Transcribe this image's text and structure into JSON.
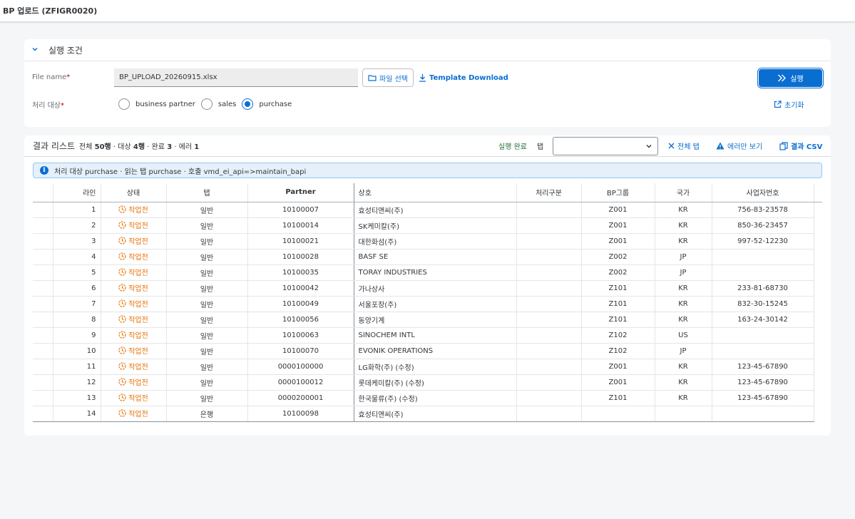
{
  "shell": {
    "title": "BP 업로드 (ZFIGR0020)"
  },
  "conditions": {
    "title": "실행 조건",
    "file_label": "File name",
    "file_value": "BP_UPLOAD_20260915.xlsx",
    "file_select_label": "파일 선택",
    "template_download_label": "Template Download",
    "run_label": "실행",
    "target_label": "처리 대상",
    "options": [
      {
        "label": "business partner",
        "selected": false
      },
      {
        "label": "sales",
        "selected": false
      },
      {
        "label": "purchase",
        "selected": true
      }
    ],
    "reset_label": "초기화"
  },
  "results": {
    "title": "결과 리스트",
    "summary": {
      "total_prefix": "전체",
      "total": "50행",
      "target_prefix": "· 대상",
      "target": "4행",
      "done_prefix": "· 완료",
      "done": "3",
      "error_prefix": "· 에러",
      "error": "1"
    },
    "run_status": "실행 완료",
    "tab_label": "탭",
    "tab_value": "",
    "all_tabs_label": "전체 탭",
    "errors_only_label": "에러만 보기",
    "csv_label": "결과 CSV",
    "info": "처리 대상 purchase · 읽는 탭 purchase · 호출 vmd_ei_api=>maintain_bapi",
    "columns": [
      "라인",
      "상태",
      "탭",
      "Partner",
      "상호",
      "처리구분",
      "BP그룹",
      "국가",
      "사업자번호"
    ],
    "rows": [
      {
        "line": "1",
        "status": "작업전",
        "tab": "일반",
        "partner": "10100007",
        "name": "효성티앤씨(주)",
        "proc": "",
        "group": "Z001",
        "country": "KR",
        "bizno": "756-83-23578"
      },
      {
        "line": "2",
        "status": "작업전",
        "tab": "일반",
        "partner": "10100014",
        "name": "SK케미칼(주)",
        "proc": "",
        "group": "Z001",
        "country": "KR",
        "bizno": "850-36-23457"
      },
      {
        "line": "3",
        "status": "작업전",
        "tab": "일반",
        "partner": "10100021",
        "name": "대한화섬(주)",
        "proc": "",
        "group": "Z001",
        "country": "KR",
        "bizno": "997-52-12230"
      },
      {
        "line": "4",
        "status": "작업전",
        "tab": "일반",
        "partner": "10100028",
        "name": "BASF SE",
        "proc": "",
        "group": "Z002",
        "country": "JP",
        "bizno": ""
      },
      {
        "line": "5",
        "status": "작업전",
        "tab": "일반",
        "partner": "10100035",
        "name": "TORAY INDUSTRIES",
        "proc": "",
        "group": "Z002",
        "country": "JP",
        "bizno": ""
      },
      {
        "line": "6",
        "status": "작업전",
        "tab": "일반",
        "partner": "10100042",
        "name": "가나상사",
        "proc": "",
        "group": "Z101",
        "country": "KR",
        "bizno": "233-81-68730"
      },
      {
        "line": "7",
        "status": "작업전",
        "tab": "일반",
        "partner": "10100049",
        "name": "서울포장(주)",
        "proc": "",
        "group": "Z101",
        "country": "KR",
        "bizno": "832-30-15245"
      },
      {
        "line": "8",
        "status": "작업전",
        "tab": "일반",
        "partner": "10100056",
        "name": "동양기계",
        "proc": "",
        "group": "Z101",
        "country": "KR",
        "bizno": "163-24-30142"
      },
      {
        "line": "9",
        "status": "작업전",
        "tab": "일반",
        "partner": "10100063",
        "name": "SINOCHEM INTL",
        "proc": "",
        "group": "Z102",
        "country": "US",
        "bizno": ""
      },
      {
        "line": "10",
        "status": "작업전",
        "tab": "일반",
        "partner": "10100070",
        "name": "EVONIK OPERATIONS",
        "proc": "",
        "group": "Z102",
        "country": "JP",
        "bizno": ""
      },
      {
        "line": "11",
        "status": "작업전",
        "tab": "일반",
        "partner": "0000100000",
        "name": "LG화학(주) (수정)",
        "proc": "",
        "group": "Z001",
        "country": "KR",
        "bizno": "123-45-67890"
      },
      {
        "line": "12",
        "status": "작업전",
        "tab": "일반",
        "partner": "0000100012",
        "name": "롯데케미칼(주) (수정)",
        "proc": "",
        "group": "Z001",
        "country": "KR",
        "bizno": "123-45-67890"
      },
      {
        "line": "13",
        "status": "작업전",
        "tab": "일반",
        "partner": "0000200001",
        "name": "한국물류(주) (수정)",
        "proc": "",
        "group": "Z101",
        "country": "KR",
        "bizno": "123-45-67890"
      },
      {
        "line": "14",
        "status": "작업전",
        "tab": "은행",
        "partner": "10100098",
        "name": "효성티앤씨(주)",
        "proc": "",
        "group": "",
        "country": "",
        "bizno": ""
      }
    ]
  },
  "colors": {
    "accent": "#0a6ed1",
    "warning": "#e9730c",
    "success": "#256f3a"
  }
}
